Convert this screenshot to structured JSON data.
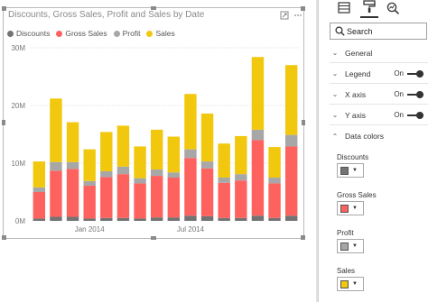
{
  "visual": {
    "title": "Discounts, Gross Sales, Profit and  Sales by Date"
  },
  "legend": [
    {
      "name": "Discounts",
      "color": "#737373"
    },
    {
      "name": "Gross Sales",
      "color": "#fd625e"
    },
    {
      "name": "Profit",
      "color": "#a7a7a7"
    },
    {
      "name": "Sales",
      "color": "#f2c80f"
    }
  ],
  "chart_data": {
    "type": "bar",
    "stacked": true,
    "title": "Discounts, Gross Sales, Profit and  Sales by Date",
    "y_ticks": [
      "0M",
      "10M",
      "20M",
      "30M"
    ],
    "ylim": [
      0,
      30
    ],
    "x_ticks": [
      "Jan 2014",
      "Jul 2014"
    ],
    "grid": true,
    "legend_position": "top-left",
    "series": [
      {
        "name": "Discounts",
        "color": "#737373",
        "values": [
          0.4,
          0.7,
          0.7,
          0.4,
          0.5,
          0.5,
          0.4,
          0.6,
          0.6,
          0.9,
          0.8,
          0.5,
          0.5,
          0.9,
          0.5,
          0.9
        ]
      },
      {
        "name": "Gross Sales",
        "color": "#fd625e",
        "values": [
          4.6,
          8.0,
          8.3,
          5.7,
          7.1,
          7.6,
          6.1,
          7.2,
          6.9,
          10.0,
          8.3,
          6.1,
          6.5,
          13.1,
          6.0,
          12.0
        ]
      },
      {
        "name": "Profit",
        "color": "#a7a7a7",
        "values": [
          0.8,
          1.5,
          1.2,
          0.8,
          1.0,
          1.3,
          0.9,
          1.1,
          0.9,
          1.5,
          1.2,
          0.9,
          1.1,
          1.8,
          1.0,
          2.0
        ]
      },
      {
        "name": "Sales",
        "color": "#f2c80f",
        "values": [
          4.5,
          11.0,
          6.9,
          5.5,
          6.8,
          7.1,
          5.5,
          6.9,
          6.2,
          9.6,
          8.3,
          5.9,
          6.6,
          12.6,
          5.3,
          12.1
        ]
      }
    ]
  },
  "pane": {
    "tabs": [
      {
        "icon": "fields-icon"
      },
      {
        "icon": "paint-roller-icon"
      },
      {
        "icon": "analytics-icon"
      }
    ],
    "search_placeholder": "Search",
    "sections": [
      {
        "label": "General",
        "expanded": false
      },
      {
        "label": "Legend",
        "expanded": false,
        "toggle": "On"
      },
      {
        "label": "X axis",
        "expanded": false,
        "toggle": "On"
      },
      {
        "label": "Y axis",
        "expanded": false,
        "toggle": "On"
      },
      {
        "label": "Data colors",
        "expanded": true
      }
    ],
    "data_colors": [
      {
        "label": "Discounts",
        "color": "#737373"
      },
      {
        "label": "Gross Sales",
        "color": "#fd625e"
      },
      {
        "label": "Profit",
        "color": "#a7a7a7"
      },
      {
        "label": "Sales",
        "color": "#f2c80f"
      }
    ]
  }
}
